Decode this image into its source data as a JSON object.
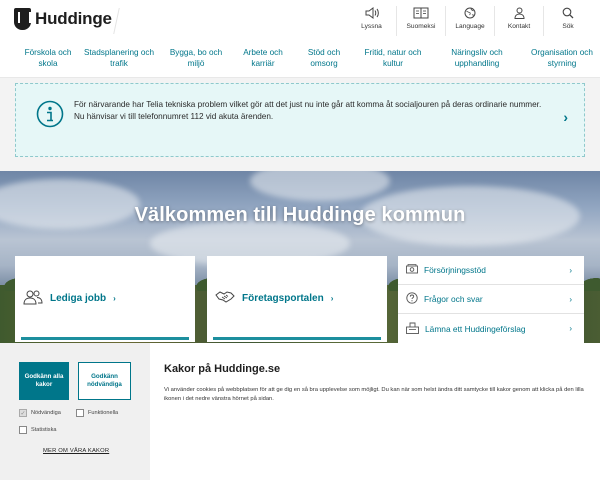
{
  "header": {
    "logo_text": "Huddinge",
    "tools": [
      {
        "label": "Lyssna",
        "icon": "speaker-icon"
      },
      {
        "label": "Suomeksi",
        "icon": "book-icon"
      },
      {
        "label": "Language",
        "icon": "globe-icon"
      },
      {
        "label": "Kontakt",
        "icon": "person-icon"
      },
      {
        "label": "Sök",
        "icon": "search-icon"
      }
    ]
  },
  "nav": {
    "items": [
      "Förskola och skola",
      "Stadsplanering och trafik",
      "Bygga, bo och miljö",
      "Arbete och karriär",
      "Stöd och omsorg",
      "Fritid, natur och kultur",
      "Näringsliv och upphandling",
      "Organisation och styrning"
    ]
  },
  "alert": {
    "text": "För närvarande har Telia tekniska problem vilket gör att det just nu inte går att komma åt socialjouren på deras ordinarie nummer. Nu hänvisar vi till telefonnumret 112 vid akuta ärenden.",
    "chevron": "›",
    "accent": "#00768a"
  },
  "hero": {
    "title": "Välkommen till Huddinge kommun"
  },
  "cards": [
    {
      "label": "Lediga jobb",
      "icon": "people-icon"
    },
    {
      "label": "Företagsportalen",
      "icon": "handshake-icon"
    }
  ],
  "quick_links": [
    {
      "label": "Försörjningsstöd",
      "icon": "money-icon"
    },
    {
      "label": "Frågor och svar",
      "icon": "question-icon"
    },
    {
      "label": "Lämna ett Huddingeförslag",
      "icon": "ballot-icon"
    }
  ],
  "cookies": {
    "accept_all": "Godkänn alla kakor",
    "accept_needed": "Godkänn nödvändiga",
    "options": [
      {
        "label": "Nödvändiga",
        "checked": true
      },
      {
        "label": "Funktionella",
        "checked": false
      },
      {
        "label": "Statistiska",
        "checked": false
      }
    ],
    "more_link": "MER OM VÅRA KAKOR",
    "title": "Kakor på Huddinge.se",
    "text": "Vi använder cookies på webbplatsen för att ge dig en så bra upplevelse som möjligt. Du kan när som helst ändra ditt samtycke till kakor genom att klicka på den lilla ikonen i det nedre vänstra hörnet på sidan."
  }
}
